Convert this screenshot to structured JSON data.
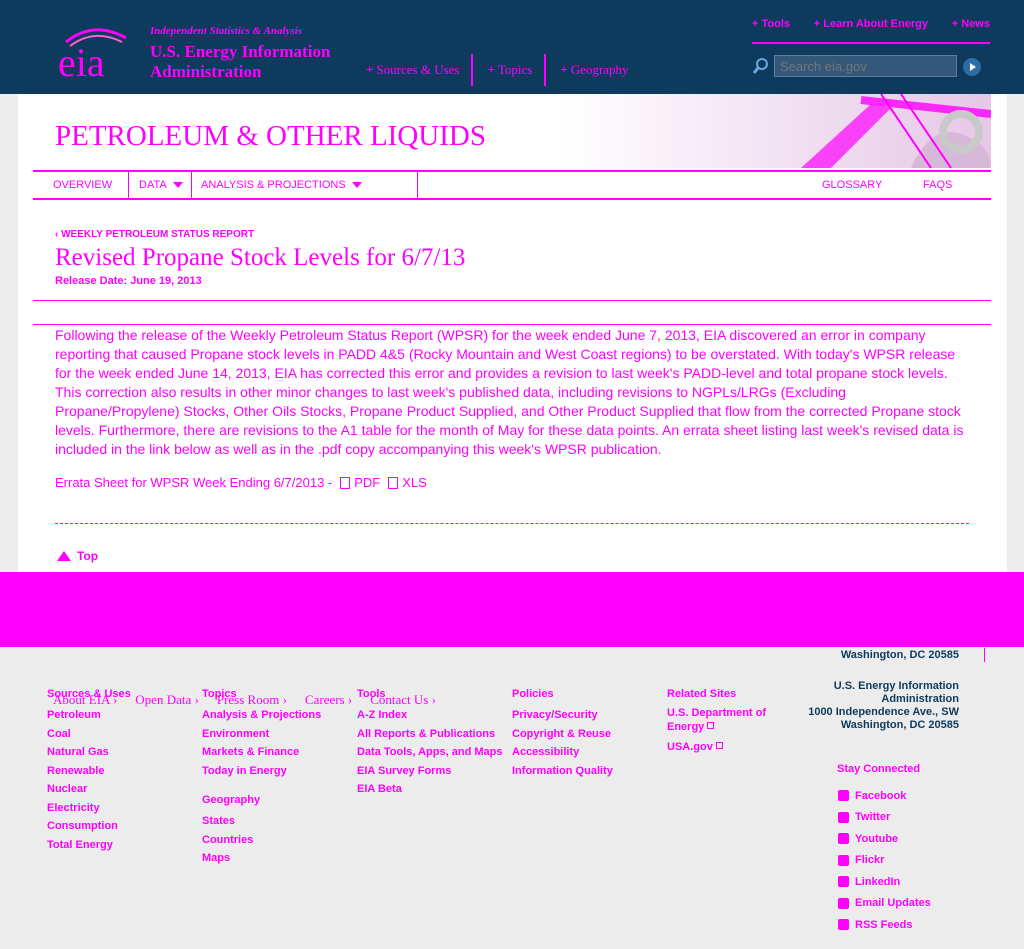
{
  "header": {
    "tagline": "Independent Statistics & Analysis",
    "org_line1": "U.S. Energy Information",
    "org_line2": "Administration",
    "main_nav": [
      {
        "label": "Sources & Uses"
      },
      {
        "label": "Topics"
      },
      {
        "label": "Geography"
      }
    ],
    "top_links": [
      {
        "label": "+ Tools"
      },
      {
        "label": "+ Learn About Energy"
      },
      {
        "label": "+ News"
      }
    ],
    "search_placeholder": "Search eia.gov"
  },
  "section": {
    "title": "PETROLEUM & OTHER LIQUIDS",
    "subnav": {
      "overview": "Overview",
      "data": "Data",
      "analysis": "Analysis & Projections",
      "glossary": "Glossary",
      "faqs": "FAQS"
    }
  },
  "article": {
    "breadcrumb": "‹ Weekly Petroleum Status Report",
    "title": "Revised Propane Stock Levels for 6/7/13",
    "release_date": "Release Date: June 19, 2013",
    "body": "Following the release of the Weekly Petroleum Status Report (WPSR) for the week ended June 7, 2013, EIA discovered an error in company reporting that caused Propane stock levels in PADD 4&5 (Rocky Mountain and West Coast regions) to be overstated. With today's WPSR release for the week ended June 14, 2013, EIA has corrected this error and provides a revision to last week's PADD-level and total propane stock levels. This correction also results in other minor changes to last week's published data, including revisions to NGPLs/LRGs (Excluding Propane/Propylene) Stocks, Other Oils Stocks, Propane Product Supplied, and Other Product Supplied that flow from the corrected Propane stock levels. Furthermore, there are revisions to the A1 table for the month of May for these data points. An errata sheet listing last week's revised data is included in the link below as well as in the .pdf copy accompanying this week's WPSR publication.",
    "errata_label": "Errata Sheet for WPSR Week Ending 6/7/2013 -",
    "pdf_label": "PDF",
    "xls_label": "XLS",
    "top_label": "Top"
  },
  "footer": {
    "columns": [
      {
        "head": "Sources & Uses",
        "links": [
          "Petroleum",
          "Coal",
          "Natural Gas",
          "Renewable",
          "Nuclear",
          "Electricity",
          "Consumption",
          "Total Energy"
        ]
      },
      {
        "head": "Topics",
        "links": [
          "Analysis & Projections",
          "Environment",
          "Markets & Finance",
          "Today in Energy"
        ],
        "head2": "Geography",
        "links2": [
          "States",
          "Countries",
          "Maps"
        ]
      },
      {
        "head": "Tools",
        "links": [
          "A-Z Index",
          "All Reports & Publications",
          "Data Tools, Apps, and Maps",
          "EIA Survey Forms",
          "EIA Beta"
        ]
      },
      {
        "head": "Policies",
        "links": [
          "Privacy/Security",
          "Copyright & Reuse",
          "Accessibility",
          "Information Quality"
        ]
      },
      {
        "head": "Related Sites",
        "links": [
          "U.S. Department of Energy",
          "USA.gov"
        ]
      }
    ],
    "address_top": "Washington, DC 20585",
    "address": [
      "U.S. Energy Information Administration",
      "1000 Independence Ave., SW",
      "Washington, DC 20585"
    ],
    "stay_connected": "Stay Connected",
    "social": [
      "Facebook",
      "Twitter",
      "Youtube",
      "Flickr",
      "LinkedIn",
      "Email Updates",
      "RSS Feeds"
    ],
    "ghost_nav": [
      "About EIA",
      "Open Data",
      "Press Room",
      "Careers",
      "Contact Us"
    ]
  }
}
